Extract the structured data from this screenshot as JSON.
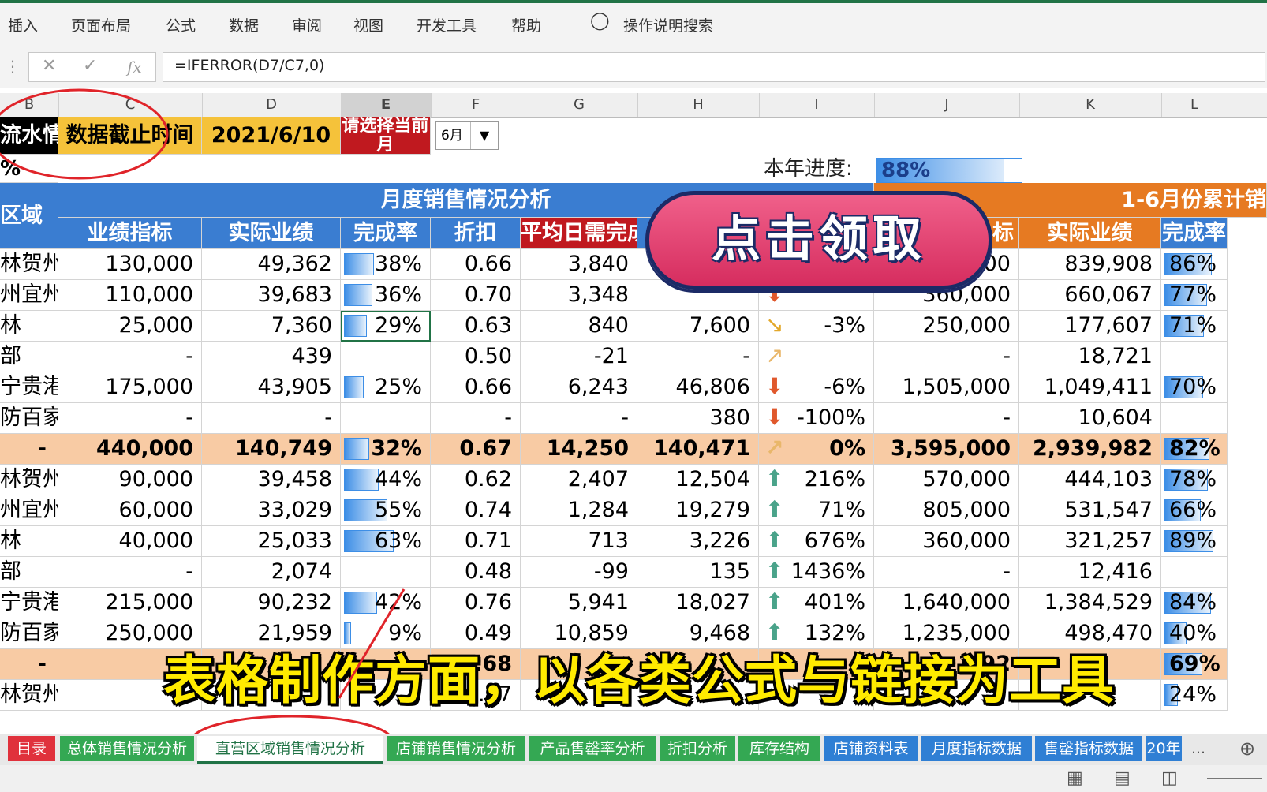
{
  "ribbon": {
    "tabs": [
      "插入",
      "页面布局",
      "公式",
      "数据",
      "审阅",
      "视图",
      "开发工具",
      "帮助"
    ],
    "search_label": "操作说明搜索"
  },
  "formula_bar": {
    "cancel_icon": "close-icon",
    "enter_icon": "check-icon",
    "fx_label": "fx",
    "formula": "=IFERROR(D7/C7,0)"
  },
  "columns": [
    "B",
    "C",
    "D",
    "E",
    "F",
    "G",
    "H",
    "I",
    "J",
    "K",
    "L"
  ],
  "header_block": {
    "b1": "流水情",
    "c1": "数据截止时间",
    "d1": "2021/6/10",
    "e1": "请选择当前月",
    "month_select": "6月",
    "b2": "%",
    "progress_label": "本年进度:",
    "progress_value": "88%",
    "progress_fraction": 0.88
  },
  "section_titles": {
    "region": "区域",
    "monthly": "月度销售情况分析",
    "cumulative": "1-6月份累计销"
  },
  "col_headers": {
    "C": "业绩指标",
    "D": "实际业绩",
    "E": "完成率",
    "F": "折扣",
    "G": "平均日需完成",
    "J": "标",
    "K": "实际业绩",
    "L": "完成率"
  },
  "rows": [
    {
      "b": "林贺州",
      "c": "130,000",
      "d": "49,362",
      "e": "38%",
      "ef": 0.38,
      "f": "0.66",
      "g": "3,840",
      "h": "",
      "i_arrow": "",
      "i": "",
      "j": "000",
      "k": "839,908",
      "l": "86%",
      "lf": 0.86,
      "total": false
    },
    {
      "b": "州宜州",
      "c": "110,000",
      "d": "39,683",
      "e": "36%",
      "ef": 0.36,
      "f": "0.70",
      "g": "3,348",
      "h": "",
      "i_arrow": "down",
      "i": "",
      "j": "360,000",
      "k": "660,067",
      "l": "77%",
      "lf": 0.77,
      "total": false
    },
    {
      "b": "林",
      "c": "25,000",
      "d": "7,360",
      "e": "29%",
      "ef": 0.29,
      "f": "0.63",
      "g": "840",
      "h": "7,600",
      "i_arrow": "down-right",
      "i": "-3%",
      "j": "250,000",
      "k": "177,607",
      "l": "71%",
      "lf": 0.71,
      "total": false
    },
    {
      "b": "部",
      "c": "-",
      "d": "439",
      "e": "",
      "ef": 0,
      "f": "0.50",
      "g": "-21",
      "h": "-",
      "i_arrow": "up-right-pale",
      "i": "",
      "j": "-",
      "k": "18,721",
      "l": "",
      "lf": 0,
      "total": false
    },
    {
      "b": "宁贵港",
      "c": "175,000",
      "d": "43,905",
      "e": "25%",
      "ef": 0.25,
      "f": "0.66",
      "g": "6,243",
      "h": "46,806",
      "i_arrow": "down",
      "i": "-6%",
      "j": "1,505,000",
      "k": "1,049,411",
      "l": "70%",
      "lf": 0.7,
      "total": false
    },
    {
      "b": "防百家",
      "c": "-",
      "d": "-",
      "e": "",
      "ef": 0,
      "f": "-",
      "g": "-",
      "h": "380",
      "i_arrow": "down",
      "i": "-100%",
      "j": "-",
      "k": "10,604",
      "l": "",
      "lf": 0,
      "total": false
    },
    {
      "b": "-",
      "c": "440,000",
      "d": "140,749",
      "e": "32%",
      "ef": 0.32,
      "f": "0.67",
      "g": "14,250",
      "h": "140,471",
      "i_arrow": "up-right-pale",
      "i": "0%",
      "j": "3,595,000",
      "k": "2,939,982",
      "l": "82%",
      "lf": 0.82,
      "total": true
    },
    {
      "b": "林贺州",
      "c": "90,000",
      "d": "39,458",
      "e": "44%",
      "ef": 0.44,
      "f": "0.62",
      "g": "2,407",
      "h": "12,504",
      "i_arrow": "up",
      "i": "216%",
      "j": "570,000",
      "k": "444,103",
      "l": "78%",
      "lf": 0.78,
      "total": false
    },
    {
      "b": "州宜州",
      "c": "60,000",
      "d": "33,029",
      "e": "55%",
      "ef": 0.55,
      "f": "0.74",
      "g": "1,284",
      "h": "19,279",
      "i_arrow": "up",
      "i": "71%",
      "j": "805,000",
      "k": "531,547",
      "l": "66%",
      "lf": 0.66,
      "total": false
    },
    {
      "b": "林",
      "c": "40,000",
      "d": "25,033",
      "e": "63%",
      "ef": 0.63,
      "f": "0.71",
      "g": "713",
      "h": "3,226",
      "i_arrow": "up",
      "i": "676%",
      "j": "360,000",
      "k": "321,257",
      "l": "89%",
      "lf": 0.89,
      "total": false
    },
    {
      "b": "部",
      "c": "-",
      "d": "2,074",
      "e": "",
      "ef": 0,
      "f": "0.48",
      "g": "-99",
      "h": "135",
      "i_arrow": "up",
      "i": "1436%",
      "j": "-",
      "k": "12,416",
      "l": "",
      "lf": 0,
      "total": false
    },
    {
      "b": "宁贵港",
      "c": "215,000",
      "d": "90,232",
      "e": "42%",
      "ef": 0.42,
      "f": "0.76",
      "g": "5,941",
      "h": "18,027",
      "i_arrow": "up",
      "i": "401%",
      "j": "1,640,000",
      "k": "1,384,529",
      "l": "84%",
      "lf": 0.84,
      "total": false
    },
    {
      "b": "防百家",
      "c": "250,000",
      "d": "21,959",
      "e": "9%",
      "ef": 0.09,
      "f": "0.49",
      "g": "10,859",
      "h": "9,468",
      "i_arrow": "up",
      "i": "132%",
      "j": "1,235,000",
      "k": "498,470",
      "l": "40%",
      "lf": 0.4,
      "total": false
    },
    {
      "b": "-",
      "c": "",
      "d": "",
      "e": "",
      "ef": 0,
      "f": "0.68",
      "g": "",
      "h": "",
      "i_arrow": "",
      "i": "",
      "j": "3,92",
      "k": "",
      "l": "69%",
      "lf": 0.69,
      "total": true
    },
    {
      "b": "林贺州",
      "c": "",
      "d": "",
      "e": "",
      "ef": 0,
      "f": "0.47",
      "g": "",
      "h": "",
      "i_arrow": "",
      "i": "",
      "j": "",
      "k": "",
      "l": "24%",
      "lf": 0.24,
      "total": false
    }
  ],
  "overlay": {
    "claim_button": "点击领取",
    "caption": "表格制作方面，以各类公式与链接为工具"
  },
  "sheet_tabs": [
    {
      "label": "目录",
      "color": "#e0313c"
    },
    {
      "label": "总体销售情况分析",
      "color": "#34a853"
    },
    {
      "label": "直营区域销售情况分析",
      "color": "#ffffff"
    },
    {
      "label": "店铺销售情况分析",
      "color": "#34a853"
    },
    {
      "label": "产品售罄率分析",
      "color": "#34a853"
    },
    {
      "label": "折扣分析",
      "color": "#34a853"
    },
    {
      "label": "库存结构",
      "color": "#34a853"
    },
    {
      "label": "店铺资料表",
      "color": "#2f7fd4"
    },
    {
      "label": "月度指标数据",
      "color": "#2f7fd4"
    },
    {
      "label": "售罄指标数据",
      "color": "#2f7fd4"
    },
    {
      "label": "20年",
      "color": "#2f7fd4"
    }
  ],
  "tabbar": {
    "more": "...",
    "add_icon": "plus-icon"
  },
  "status_icons": [
    "normal-view-icon",
    "page-layout-icon",
    "page-break-icon"
  ]
}
